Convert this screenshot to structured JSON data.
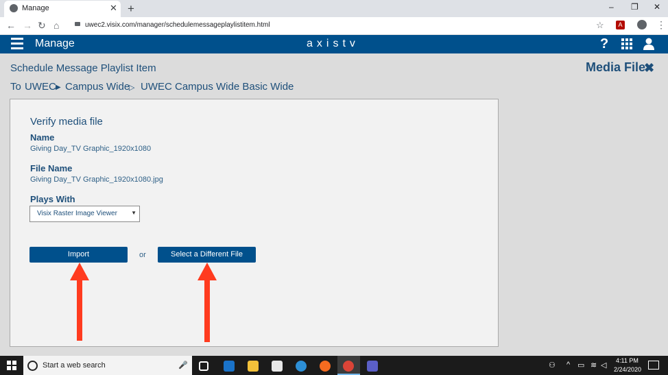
{
  "browser": {
    "tab_title": "Manage",
    "tab_close": "✕",
    "new_tab": "+",
    "url": "uwec2.visix.com/manager/schedulemessageplaylistitem.html",
    "window_controls": [
      "–",
      "❐",
      "✕"
    ],
    "nav_icons": [
      "←",
      "→",
      "↻",
      "⌂"
    ],
    "star": "☆",
    "pdf": "A",
    "menu": "⋮"
  },
  "app": {
    "title": "Manage",
    "brand": "axistv",
    "help": "?"
  },
  "page": {
    "title": "Schedule Message Playlist Item",
    "media_file_label": "Media File",
    "media_file_close": "✖",
    "breadcrumb": {
      "prefix": "To",
      "items": [
        "UWEC",
        "Campus Wide",
        "UWEC Campus Wide Basic Wide"
      ],
      "separators": [
        "▶",
        "▷"
      ]
    }
  },
  "form": {
    "heading": "Verify media file",
    "name_label": "Name",
    "name_value": "Giving Day_TV Graphic_1920x1080",
    "file_name_label": "File Name",
    "file_name_value": "Giving Day_TV Graphic_1920x1080.jpg",
    "plays_with_label": "Plays With",
    "plays_with_value": "Visix Raster Image Viewer",
    "import_button": "Import",
    "or_text": "or",
    "select_different_button": "Select a Different File"
  },
  "taskbar": {
    "search_placeholder": "Start a web search",
    "time": "4:11 PM",
    "date": "2/24/2020"
  },
  "colors": {
    "brand_blue": "#00508c",
    "text_blue": "#1e4f7a",
    "annotation_red": "#ff3b1f"
  }
}
